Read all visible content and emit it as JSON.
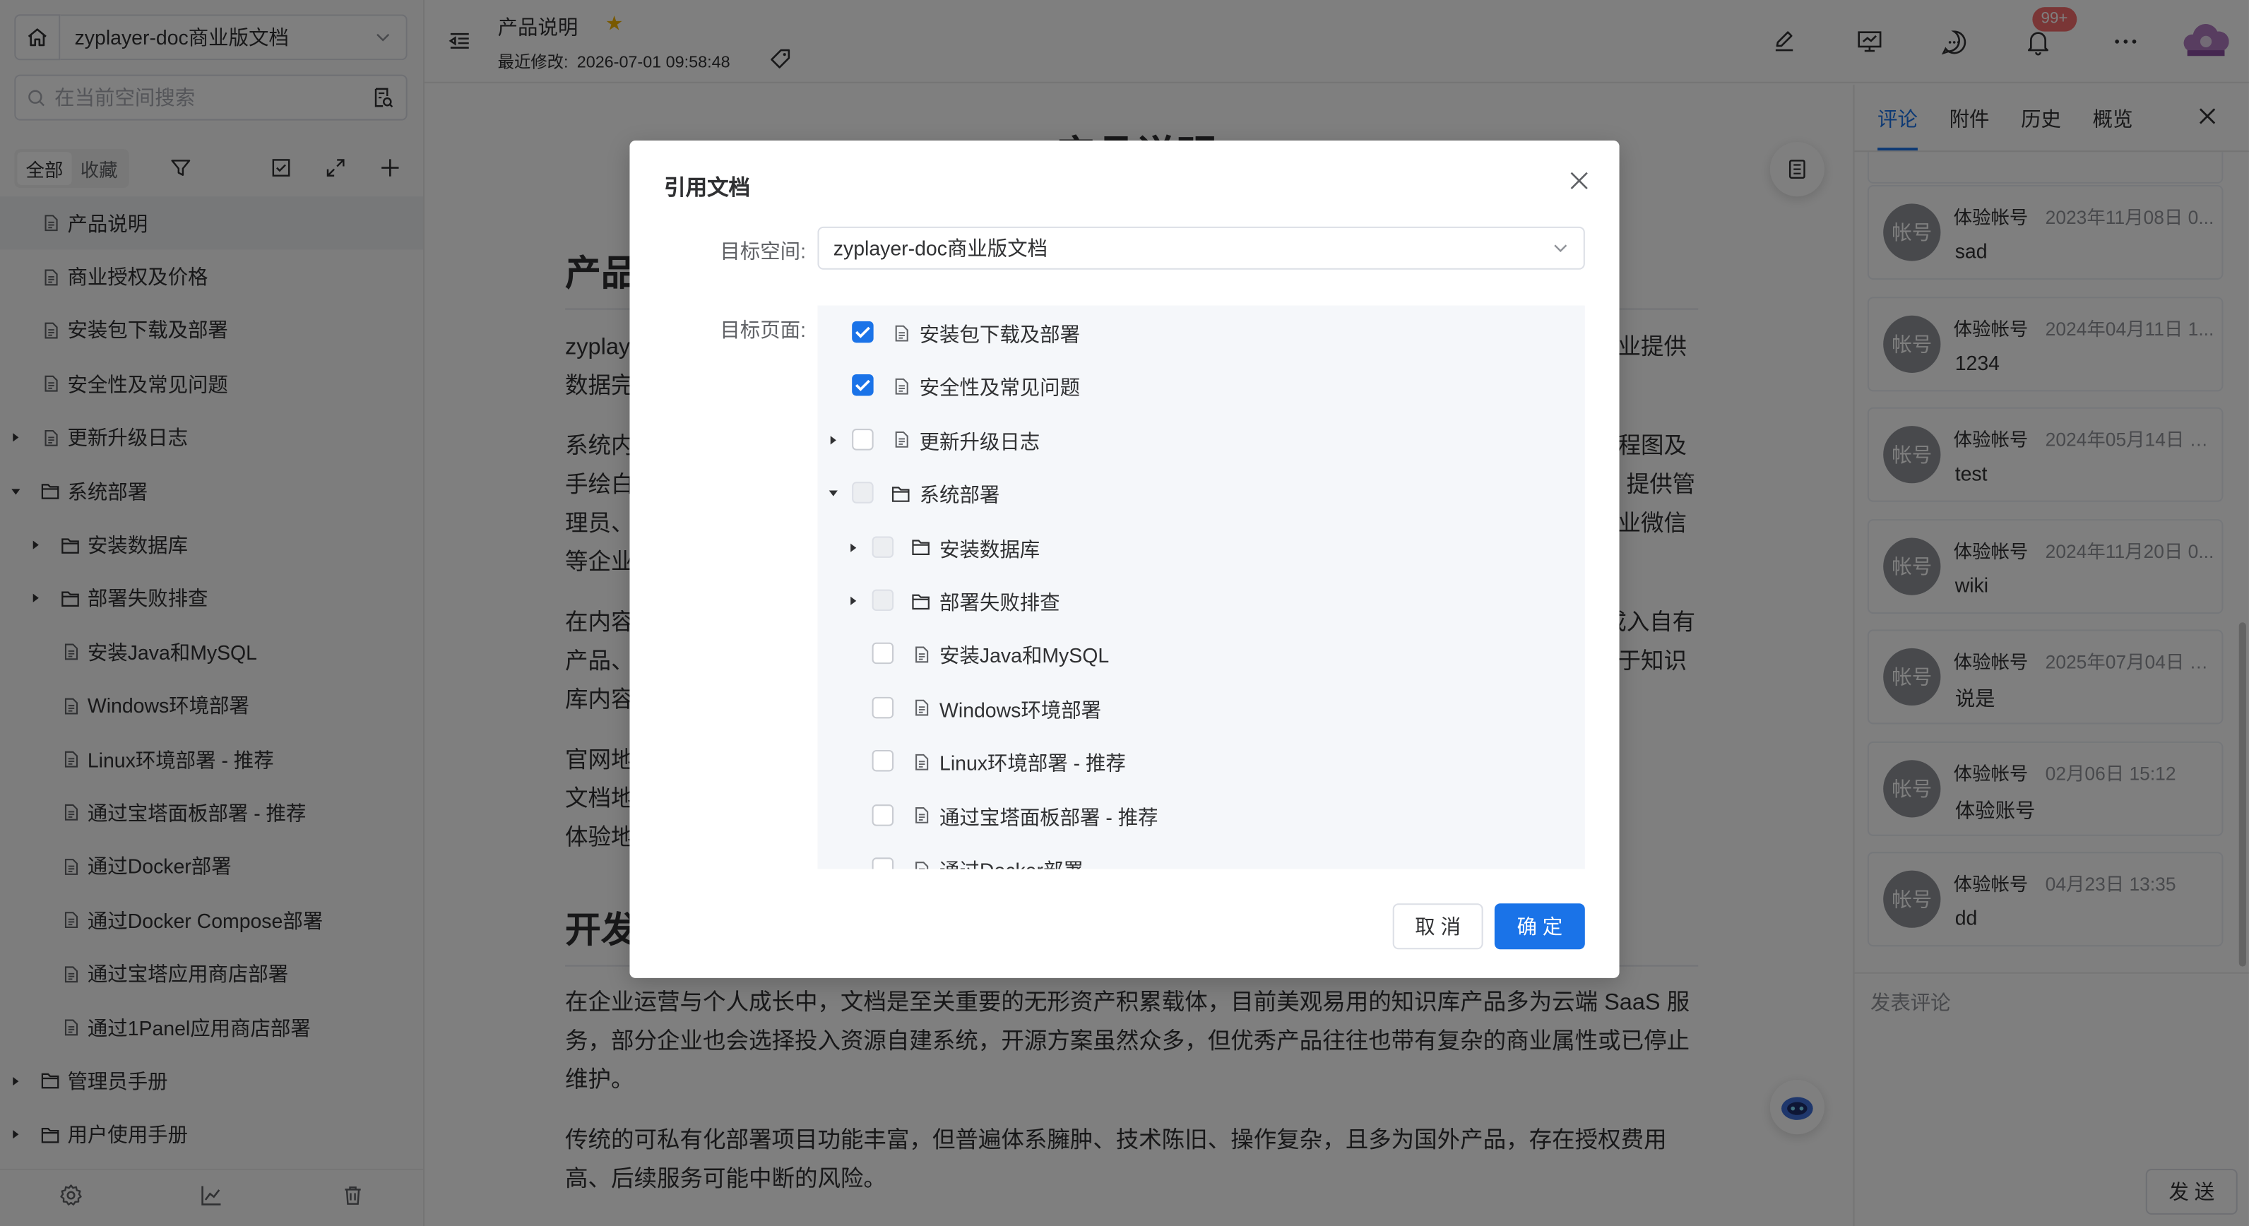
{
  "sidebar": {
    "space_name": "zyplayer-doc商业版文档",
    "search_placeholder": "在当前空间搜索",
    "filter_all": "全部",
    "filter_fav": "收藏",
    "tree": [
      {
        "label": "产品说明",
        "type": "doc",
        "level": 0,
        "arrow": "none",
        "selected": true
      },
      {
        "label": "商业授权及价格",
        "type": "doc",
        "level": 0,
        "arrow": "none"
      },
      {
        "label": "安装包下载及部署",
        "type": "doc",
        "level": 0,
        "arrow": "none"
      },
      {
        "label": "安全性及常见问题",
        "type": "doc",
        "level": 0,
        "arrow": "none"
      },
      {
        "label": "更新升级日志",
        "type": "doc",
        "level": 0,
        "arrow": "right"
      },
      {
        "label": "系统部署",
        "type": "folder",
        "level": 0,
        "arrow": "down"
      },
      {
        "label": "安装数据库",
        "type": "folder",
        "level": 1,
        "arrow": "right"
      },
      {
        "label": "部署失败排查",
        "type": "folder",
        "level": 1,
        "arrow": "right"
      },
      {
        "label": "安装Java和MySQL",
        "type": "doc",
        "level": 1,
        "arrow": "none"
      },
      {
        "label": "Windows环境部署",
        "type": "doc",
        "level": 1,
        "arrow": "none"
      },
      {
        "label": "Linux环境部署 - 推荐",
        "type": "doc",
        "level": 1,
        "arrow": "none"
      },
      {
        "label": "通过宝塔面板部署 - 推荐",
        "type": "doc",
        "level": 1,
        "arrow": "none"
      },
      {
        "label": "通过Docker部署",
        "type": "doc",
        "level": 1,
        "arrow": "none"
      },
      {
        "label": "通过Docker Compose部署",
        "type": "doc",
        "level": 1,
        "arrow": "none"
      },
      {
        "label": "通过宝塔应用商店部署",
        "type": "doc",
        "level": 1,
        "arrow": "none"
      },
      {
        "label": "通过1Panel应用商店部署",
        "type": "doc",
        "level": 1,
        "arrow": "none"
      },
      {
        "label": "管理员手册",
        "type": "folder",
        "level": 0,
        "arrow": "right"
      },
      {
        "label": "用户使用手册",
        "type": "folder",
        "level": 0,
        "arrow": "right"
      }
    ]
  },
  "header": {
    "doc_title": "产品说明",
    "modified_label": "最近修改:",
    "modified_time": "2026-07-01 09:58:48",
    "notify_badge": "99+"
  },
  "doc": {
    "h1": "产品说明",
    "h2a": "产品",
    "h2b": "开发",
    "frag1": "zyplay",
    "frag1r": "业提供",
    "frag2": "数据完",
    "frag3": "系统内",
    "frag3r": "程图及",
    "frag4": "手绘白",
    "frag4r": "提供管",
    "frag5": "理员、",
    "frag5r": "业微信",
    "frag6": "等企业",
    "frag7": "在内容",
    "frag7r": "成入自有",
    "frag8": "产品、",
    "frag8r": "于知识",
    "frag9": "库内容",
    "frag10": "官网地",
    "frag11": "文档地",
    "frag12": "体验地",
    "para1": "在企业运营与个人成长中，文档是至关重要的无形资产积累载体，目前美观易用的知识库产品多为云端 SaaS 服务，部分企业也会选择投入资源自建系统，开源方案虽然众多，但优秀产品往往也带有复杂的商业属性或已停止维护。",
    "para2": "传统的可私有化部署项目功能丰富，但普遍体系臃肿、技术陈旧、操作复杂，且多为国外产品，存在授权费用高、后续服务可能中断的风险。"
  },
  "rpanel": {
    "tabs": [
      "评论",
      "附件",
      "历史",
      "概览"
    ],
    "comments": [
      {
        "avatar": "帐号",
        "name": "体验帐号",
        "time": "2023年11月08日 0...",
        "text": "sad"
      },
      {
        "avatar": "帐号",
        "name": "体验帐号",
        "time": "2024年04月11日 1...",
        "text": "1234"
      },
      {
        "avatar": "帐号",
        "name": "体验帐号",
        "time": "2024年05月14日 1...",
        "text": "test"
      },
      {
        "avatar": "帐号",
        "name": "体验帐号",
        "time": "2024年11月20日 0...",
        "text": "wiki"
      },
      {
        "avatar": "帐号",
        "name": "体验帐号",
        "time": "2025年07月04日 1...",
        "text": "说是"
      },
      {
        "avatar": "帐号",
        "name": "体验帐号",
        "time": "02月06日 15:12",
        "text": "体验账号"
      },
      {
        "avatar": "帐号",
        "name": "体验帐号",
        "time": "04月23日 13:35",
        "text": "dd"
      }
    ],
    "input_placeholder": "发表评论",
    "send_label": "发 送"
  },
  "dialog": {
    "title": "引用文档",
    "space_label": "目标空间:",
    "space_value": "zyplayer-doc商业版文档",
    "page_label": "目标页面:",
    "tree": [
      {
        "label": "安装包下载及部署",
        "type": "doc",
        "level": 0,
        "arrow": "none",
        "state": "checked"
      },
      {
        "label": "安全性及常见问题",
        "type": "doc",
        "level": 0,
        "arrow": "none",
        "state": "checked"
      },
      {
        "label": "更新升级日志",
        "type": "doc",
        "level": 0,
        "arrow": "right",
        "state": "unchecked"
      },
      {
        "label": "系统部署",
        "type": "folder",
        "level": 0,
        "arrow": "down",
        "state": "disabled"
      },
      {
        "label": "安装数据库",
        "type": "folder",
        "level": 1,
        "arrow": "right",
        "state": "disabled"
      },
      {
        "label": "部署失败排查",
        "type": "folder",
        "level": 1,
        "arrow": "right",
        "state": "disabled"
      },
      {
        "label": "安装Java和MySQL",
        "type": "doc",
        "level": 1,
        "arrow": "none",
        "state": "unchecked"
      },
      {
        "label": "Windows环境部署",
        "type": "doc",
        "level": 1,
        "arrow": "none",
        "state": "unchecked"
      },
      {
        "label": "Linux环境部署 - 推荐",
        "type": "doc",
        "level": 1,
        "arrow": "none",
        "state": "unchecked"
      },
      {
        "label": "通过宝塔面板部署 - 推荐",
        "type": "doc",
        "level": 1,
        "arrow": "none",
        "state": "unchecked"
      },
      {
        "label": "通过Docker部署",
        "type": "doc",
        "level": 1,
        "arrow": "none",
        "state": "unchecked"
      }
    ],
    "cancel_label": "取 消",
    "ok_label": "确 定"
  },
  "colors": {
    "accent": "#1a73e8",
    "badge": "#f56c6c",
    "overlay": "#000000"
  },
  "icons": {
    "doc": "file-icon",
    "folder": "folder-icon"
  }
}
